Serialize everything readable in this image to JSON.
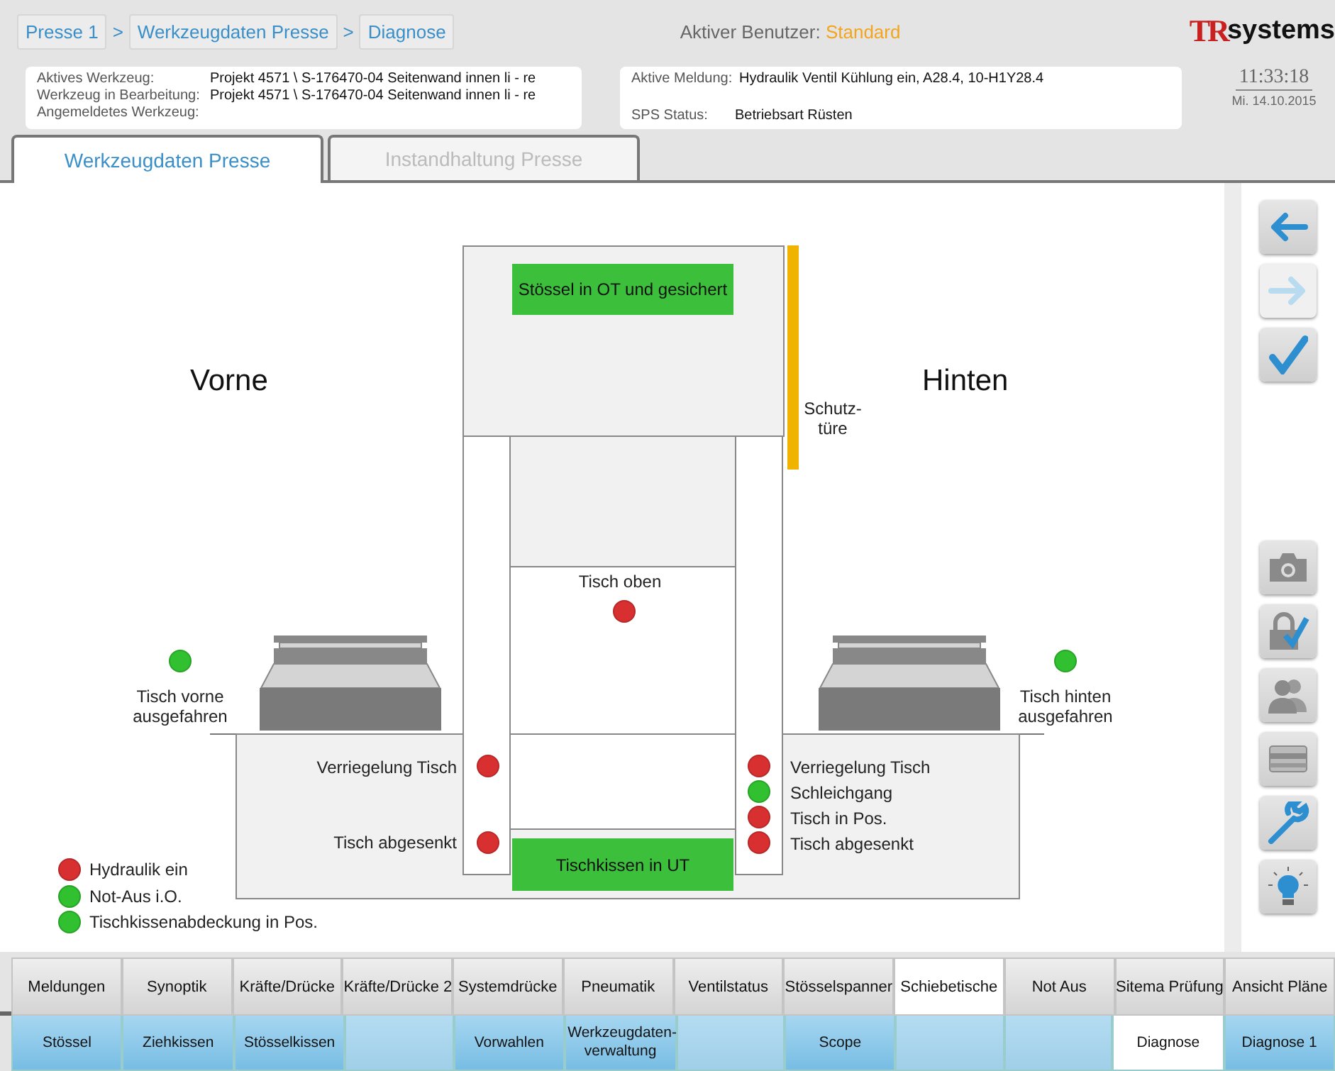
{
  "breadcrumbs": [
    "Presse 1",
    ">",
    "Werkzeugdaten Presse",
    ">",
    "Diagnose"
  ],
  "user": {
    "label": "Aktiver Benutzer:",
    "value": "Standard"
  },
  "logo": {
    "mark": "TR",
    "text": "systems"
  },
  "tool_info": [
    {
      "label": "Aktives Werkzeug:",
      "value": "Projekt 4571 \\ S-176470-04 Seitenwand innen li - re"
    },
    {
      "label": "Werkzeug in Bearbeitung:",
      "value": "Projekt 4571 \\ S-176470-04 Seitenwand innen li - re"
    },
    {
      "label": "Angemeldetes Werkzeug:"
    }
  ],
  "message_info": [
    {
      "label": "Aktive Meldung:",
      "value": "Hydraulik Ventil Kühlung ein,   A28.4, 10-H1Y28.4"
    },
    {
      "label": "SPS Status:",
      "value": "Betriebsart Rüsten"
    }
  ],
  "clock": {
    "time": "11:33:18",
    "date": "Mi. 14.10.2015"
  },
  "tabs": [
    {
      "label": "Werkzeugdaten Presse",
      "selected": true
    },
    {
      "label": "Instandhaltung Presse",
      "selected": false
    }
  ],
  "diagram": {
    "front_label": "Vorne",
    "rear_label": "Hinten",
    "ram_status": "Stössel in OT und gesichert",
    "door_label": "Schutz-türe",
    "table_top": {
      "label": "Tisch oben",
      "color": "#d83030"
    },
    "cushion_status": "Tischkissen in UT",
    "front_table": {
      "label": "Tisch vorne ausgefahren",
      "color": "#30c030"
    },
    "rear_table": {
      "label": "Tisch hinten ausgefahren",
      "color": "#30c030"
    },
    "left_indicators": [
      {
        "label": "Verriegelung Tisch",
        "color": "#d83030"
      },
      {
        "label": "Tisch abgesenkt",
        "color": "#d83030"
      }
    ],
    "right_indicators": [
      {
        "label": "Verriegelung Tisch",
        "color": "#d83030"
      },
      {
        "label": "Schleichgang",
        "color": "#30c030"
      },
      {
        "label": "Tisch in Pos.",
        "color": "#d83030"
      },
      {
        "label": "Tisch abgesenkt",
        "color": "#d83030"
      }
    ],
    "legend": [
      {
        "label": "Hydraulik ein",
        "color": "#d83030"
      },
      {
        "label": "Not-Aus i.O.",
        "color": "#30c030"
      },
      {
        "label": "Tischkissenabdeckung in Pos.",
        "color": "#30c030"
      }
    ]
  },
  "sidebar": [
    {
      "kind": "back",
      "disabled": false
    },
    {
      "kind": "forward",
      "disabled": true
    },
    {
      "kind": "confirm",
      "disabled": false
    },
    {
      "kind": "spacer"
    },
    {
      "kind": "camera",
      "disabled": false
    },
    {
      "kind": "lock",
      "disabled": false
    },
    {
      "kind": "users",
      "disabled": false
    },
    {
      "kind": "card",
      "disabled": false
    },
    {
      "kind": "wrench",
      "disabled": false
    },
    {
      "kind": "bulb",
      "disabled": false
    }
  ],
  "nav_top": [
    {
      "label": "Meldungen",
      "selected": false
    },
    {
      "label": "Synoptik",
      "selected": false
    },
    {
      "label": "Kräfte/Drücke",
      "selected": false
    },
    {
      "label": "Kräfte/Drücke 2",
      "selected": false
    },
    {
      "label": "Systemdrücke",
      "selected": false
    },
    {
      "label": "Pneumatik",
      "selected": false
    },
    {
      "label": "Ventilstatus",
      "selected": false
    },
    {
      "label": "Stösselspanner",
      "selected": false
    },
    {
      "label": "Schiebetische",
      "selected": true
    },
    {
      "label": "Not Aus",
      "selected": false
    },
    {
      "label": "Sitema Prüfung",
      "selected": false
    },
    {
      "label": "Ansicht Pläne",
      "selected": false
    }
  ],
  "nav_bottom": [
    {
      "label": "Stössel",
      "selected": false
    },
    {
      "label": "Ziehkissen",
      "selected": false
    },
    {
      "label": "Stösselkissen",
      "selected": false
    },
    {
      "selected": false
    },
    {
      "label": "Vorwahlen",
      "selected": false
    },
    {
      "label": "Werkzeugdaten-verwaltung",
      "selected": false
    },
    {
      "selected": false
    },
    {
      "label": "Scope",
      "selected": false
    },
    {
      "selected": false
    },
    {
      "selected": false
    },
    {
      "label": "Diagnose",
      "selected": true
    },
    {
      "label": "Diagnose 1",
      "selected": false
    }
  ]
}
